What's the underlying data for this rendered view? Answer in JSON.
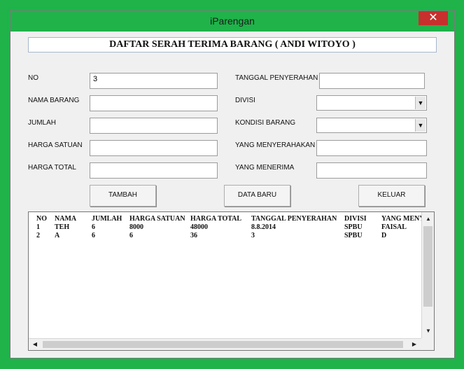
{
  "window": {
    "title": "iParengan",
    "close_glyph": "✕"
  },
  "form": {
    "header": "DAFTAR SERAH  TERIMA BARANG  ( ANDI WITOYO )",
    "labels": {
      "no": "NO",
      "nama_barang": "NAMA BARANG",
      "jumlah": "JUMLAH",
      "harga_satuan": "HARGA SATUAN",
      "harga_total": "HARGA TOTAL",
      "tanggal_penyerahan": "TANGGAL PENYERAHAN",
      "divisi": "DIVISI",
      "kondisi_barang": "KONDISI BARANG",
      "yang_menyerahakan": "YANG MENYERAHAKAN",
      "yang_menerima": "YANG MENERIMA"
    },
    "values": {
      "no": "3",
      "nama_barang": "",
      "jumlah": "",
      "harga_satuan": "",
      "harga_total": "",
      "tanggal_penyerahan": "",
      "divisi": "",
      "kondisi_barang": "",
      "yang_menyerahakan": "",
      "yang_menerima": ""
    }
  },
  "buttons": {
    "tambah": "TAMBAH",
    "data_baru": "DATA BARU",
    "keluar": "KELUAR"
  },
  "list": {
    "columns": [
      "NO",
      "NAMA",
      "JUMLAH",
      "HARGA SATUAN",
      "HARGA TOTAL",
      "TANGGAL PENYERAHAN",
      "DIVISI",
      "YANG MENYI"
    ],
    "rows": [
      [
        "1",
        "TEH",
        "6",
        "8000",
        "48000",
        "8.8.2014",
        "SPBU",
        "FAISAL"
      ],
      [
        "2",
        "A",
        "6",
        "6",
        "36",
        "3",
        "SPBU",
        "D"
      ]
    ]
  },
  "icons": {
    "up": "▲",
    "down": "▼",
    "left": "◀",
    "right": "▶",
    "dropdown": "▼"
  },
  "colors": {
    "background": "#1fb34a",
    "close": "#c7302c"
  }
}
